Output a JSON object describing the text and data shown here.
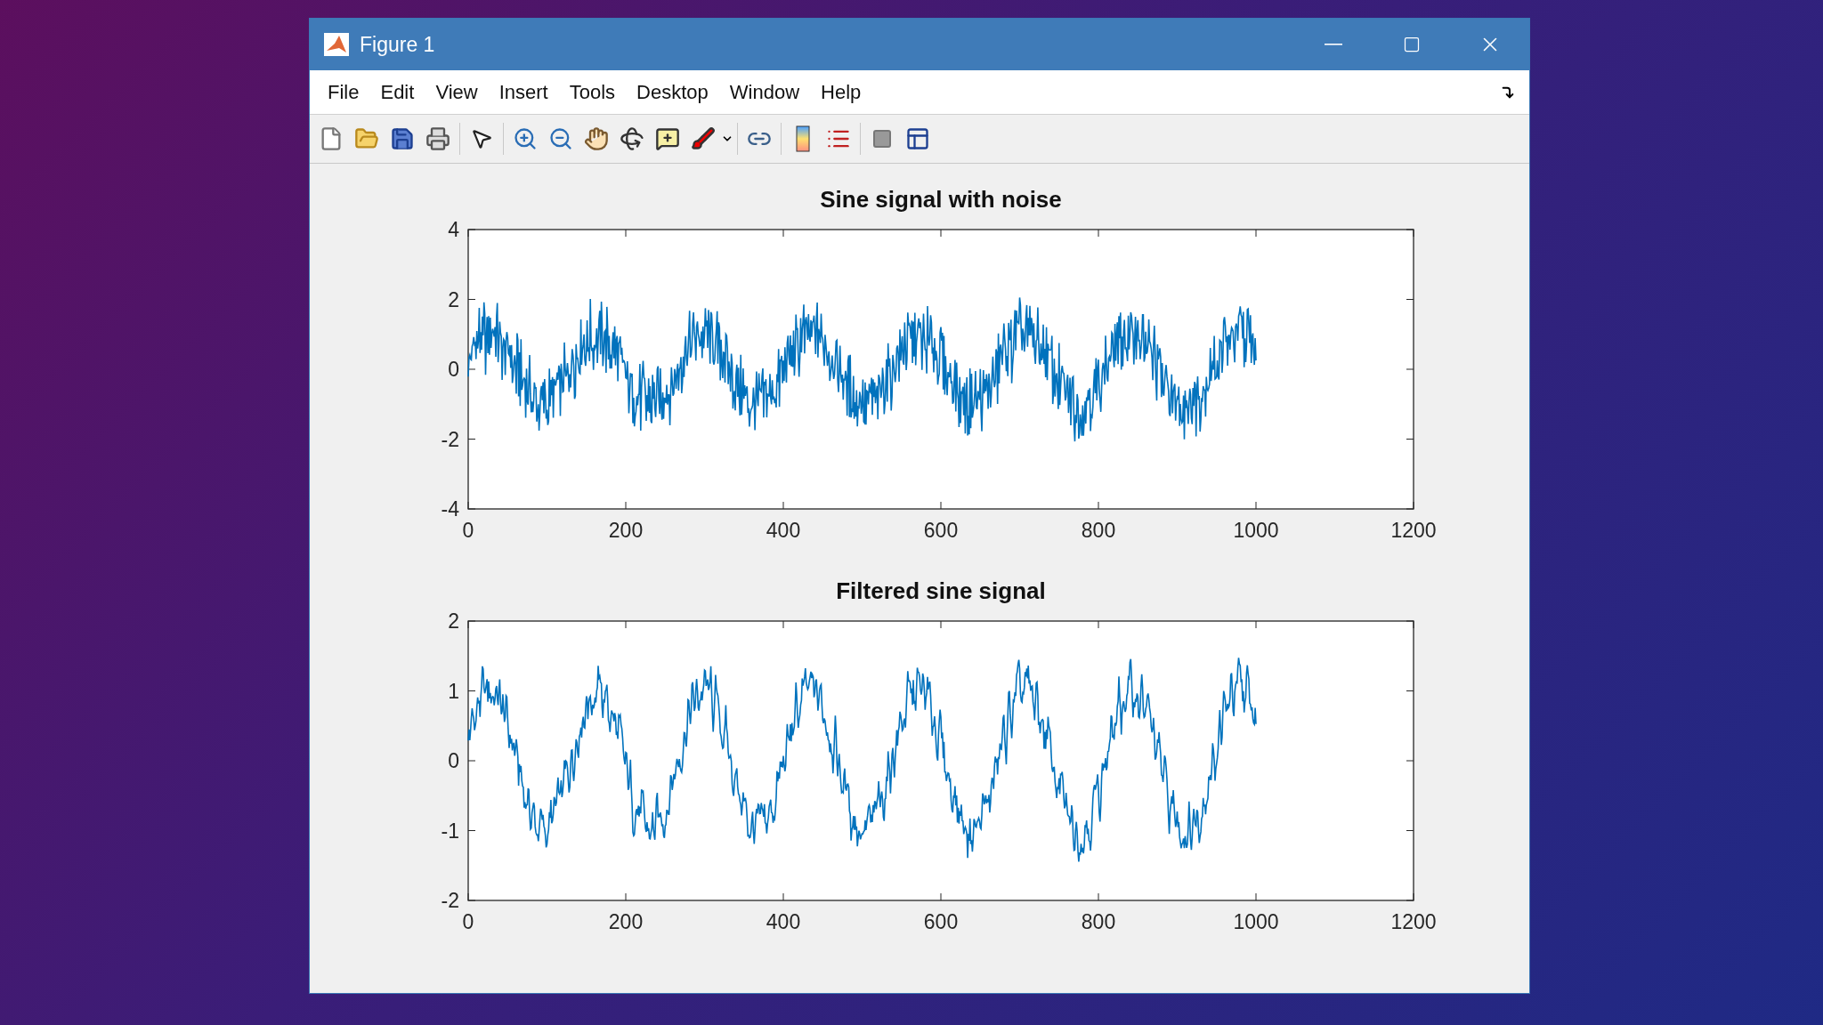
{
  "window": {
    "title": "Figure 1"
  },
  "menu": [
    "File",
    "Edit",
    "View",
    "Insert",
    "Tools",
    "Desktop",
    "Window",
    "Help"
  ],
  "plots": [
    {
      "kind": "noisy",
      "title": "Sine signal with noise",
      "xticks": [
        "0",
        "200",
        "400",
        "600",
        "800",
        "1000",
        "1200"
      ],
      "yticks": [
        "4",
        "2",
        "0",
        "-2",
        "-4"
      ]
    },
    {
      "kind": "filtered",
      "title": "Filtered sine signal",
      "xticks": [
        "0",
        "200",
        "400",
        "600",
        "800",
        "1000",
        "1200"
      ],
      "yticks": [
        "2",
        "1",
        "0",
        "-1",
        "-2"
      ]
    }
  ]
}
